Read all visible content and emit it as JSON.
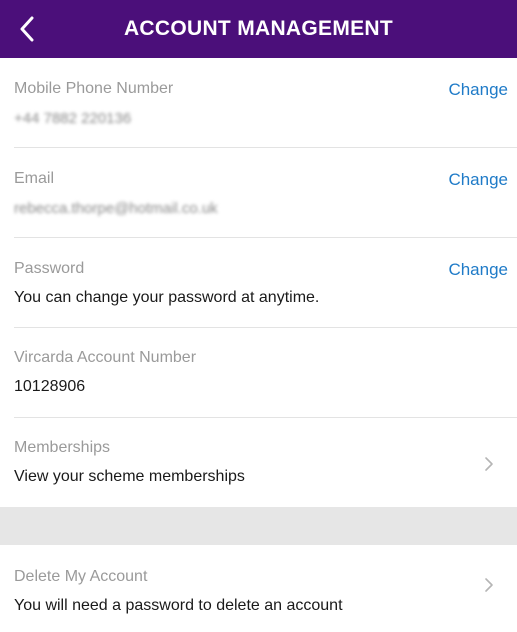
{
  "header": {
    "title": "ACCOUNT MANAGEMENT",
    "back_icon": "chevron-left-icon",
    "background": "#4b0f7a"
  },
  "rows": {
    "phone": {
      "label": "Mobile Phone Number",
      "value": "+44 7882 220136",
      "action": "Change"
    },
    "email": {
      "label": "Email",
      "value": "rebecca.thorpe@hotmail.co.uk",
      "action": "Change"
    },
    "password": {
      "label": "Password",
      "value": "You can change your password at anytime.",
      "action": "Change"
    },
    "account_number": {
      "label": "Vircarda Account Number",
      "value": "10128906"
    },
    "memberships": {
      "label": "Memberships",
      "value": "View your scheme memberships",
      "icon": "chevron-right-icon"
    },
    "delete_account": {
      "label": "Delete My Account",
      "value": "You will need a password to delete an account",
      "icon": "chevron-right-icon"
    }
  },
  "colors": {
    "accent_link": "#1f7bc8",
    "label_gray": "#9a9a9a",
    "band_gray": "#e6e6e6"
  }
}
